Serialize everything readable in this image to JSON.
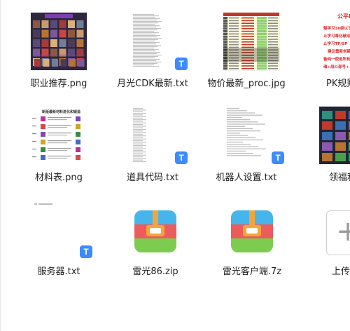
{
  "files": [
    {
      "name": "职业推荐.png",
      "type": "image"
    },
    {
      "name": "月光CDK最新.txt",
      "type": "text"
    },
    {
      "name": "物价最新_proc.jpg",
      "type": "image"
    },
    {
      "name": "PK规则",
      "type": "image"
    },
    {
      "name": "材料表.png",
      "type": "image"
    },
    {
      "name": "道具代码.txt",
      "type": "text"
    },
    {
      "name": "机器人设置.txt",
      "type": "text"
    },
    {
      "name": "领福利",
      "type": "image"
    },
    {
      "name": "服务器.txt",
      "type": "text"
    },
    {
      "name": "雷光86.zip",
      "type": "archive"
    },
    {
      "name": "雷光客户端.7z",
      "type": "archive"
    },
    {
      "name": "上传文",
      "type": "upload"
    }
  ],
  "icons": {
    "text_badge": "T",
    "upload_plus": "+"
  },
  "thumb_text": {
    "pk_title": "公平PK",
    "pk_lines": [
      "魁学习30级以下",
      "止学习毒化破动",
      "止学习TP/SP",
      "建议重新创建一",
      "备纯一使用所有",
      "魂+战斗部号+"
    ],
    "material_title": "新版最新材料进化和锻造"
  },
  "colors": {
    "accent_blue": "#3d8bfd",
    "zip_top": "#46b5ec",
    "zip_middle": "#ec5c5c",
    "zip_bottom": "#7ccd4f",
    "zip_buckle": "#f5a43a",
    "pk_red": "#e0262a"
  }
}
